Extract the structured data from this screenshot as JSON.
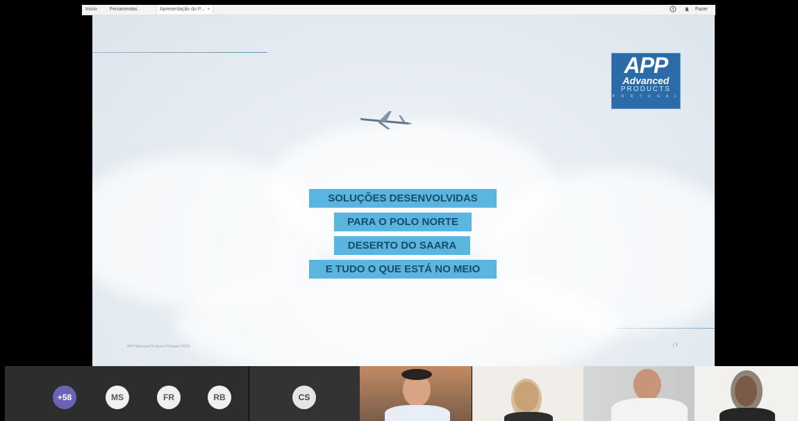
{
  "tabs": [
    {
      "label": "Início"
    },
    {
      "label": "Ferramentas"
    },
    {
      "label": "Apresentação do P...",
      "close": "×"
    }
  ],
  "topbar": {
    "signin": "Fazer log"
  },
  "slide": {
    "logo": {
      "app": "APP",
      "advanced": "Advanced",
      "products": "PRODUCTS",
      "portugal": "P O R T U G A L"
    },
    "headlines": [
      "SOLUÇÕES DESENVOLVIDAS",
      "PARA O POLO NORTE",
      "DESERTO DO SAARA",
      "E TUDO O QUE ESTÁ NO MEIO"
    ],
    "page": "| 3",
    "footer": "APP Advanced Products Portugal ©2020"
  },
  "participants": {
    "overflow": "+58",
    "initials": [
      "MS",
      "FR",
      "RB"
    ],
    "cs": "CS"
  },
  "colors": {
    "headline_bg": "#5ab6df",
    "headline_text": "#184a6c",
    "logo_bg": "#2b6ca8",
    "overflow_avatar": "#6b63b5",
    "initials_avatar": "#f0f0f0",
    "cs_avatar": "#e6e6e6"
  }
}
